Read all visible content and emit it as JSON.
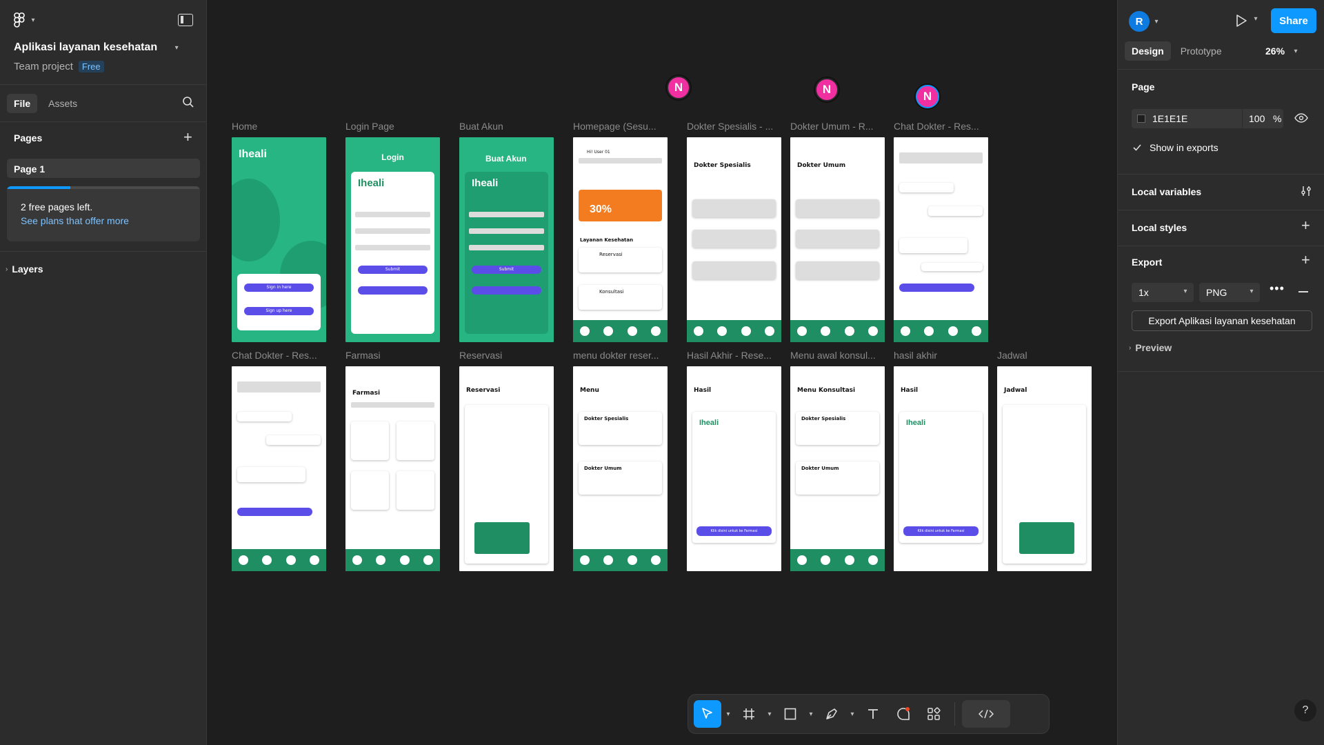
{
  "left_panel": {
    "file_title": "Aplikasi layanan kesehatan",
    "team": "Team project",
    "plan_badge": "Free",
    "tabs": [
      "File",
      "Assets"
    ],
    "pages_heading": "Pages",
    "page_item": "Page 1",
    "notice_text": "2 free pages left.",
    "notice_link": "See plans that offer more",
    "layers_heading": "Layers"
  },
  "right_panel": {
    "avatar_letter": "R",
    "share_label": "Share",
    "tabs": [
      "Design",
      "Prototype"
    ],
    "zoom": "26%",
    "page_heading": "Page",
    "bg_hex": "1E1E1E",
    "bg_opacity": "100",
    "percent_sign": "%",
    "show_exports": "Show in exports",
    "local_variables": "Local variables",
    "local_styles": "Local styles",
    "export_heading": "Export",
    "export_scale": "1x",
    "export_format": "PNG",
    "export_button": "Export Aplikasi layanan kesehatan",
    "preview": "Preview"
  },
  "canvas": {
    "cursor_letter": "N",
    "frames_row1": [
      {
        "label": "Home"
      },
      {
        "label": "Login Page"
      },
      {
        "label": "Buat Akun"
      },
      {
        "label": "Homepage (Sesu..."
      },
      {
        "label": "Dokter Spesialis - ..."
      },
      {
        "label": "Dokter Umum - R..."
      },
      {
        "label": "Chat Dokter - Res..."
      }
    ],
    "frames_row2": [
      {
        "label": "Chat Dokter - Res..."
      },
      {
        "label": "Farmasi"
      },
      {
        "label": "Reservasi"
      },
      {
        "label": "menu dokter reser..."
      },
      {
        "label": "Hasil Akhir - Rese..."
      },
      {
        "label": "Menu awal konsul..."
      },
      {
        "label": "hasil akhir"
      },
      {
        "label": "Jadwal"
      }
    ],
    "screen_text": {
      "brand": "Iheali",
      "login": "Login",
      "buat_akun": "Buat Akun",
      "dokter_spesialis": "Dokter Spesialis",
      "dokter_umum": "Dokter Umum",
      "farmasi": "Farmasi",
      "reservasi": "Reservasi",
      "menu": "Menu",
      "hasil": "Hasil",
      "menu_konsultasi": "Menu Konsultasi",
      "jadwal": "Jadwal",
      "layanan": "Layanan Kesehatan",
      "konsultasi": "Konsultasi",
      "sign_in": "Sign in here",
      "sign_up": "Sign up here",
      "submit": "Submit",
      "farmasi_btn": "Klik disini untuk ke Farmasi",
      "hi_user": "Hi! User 01",
      "promo": "30%"
    }
  },
  "colors": {
    "accent": "#0d99ff",
    "app_green": "#26b583",
    "app_dark_green": "#1f8f63",
    "app_purple": "#5b4ee8",
    "cursor_pink": "#f02fa0"
  }
}
